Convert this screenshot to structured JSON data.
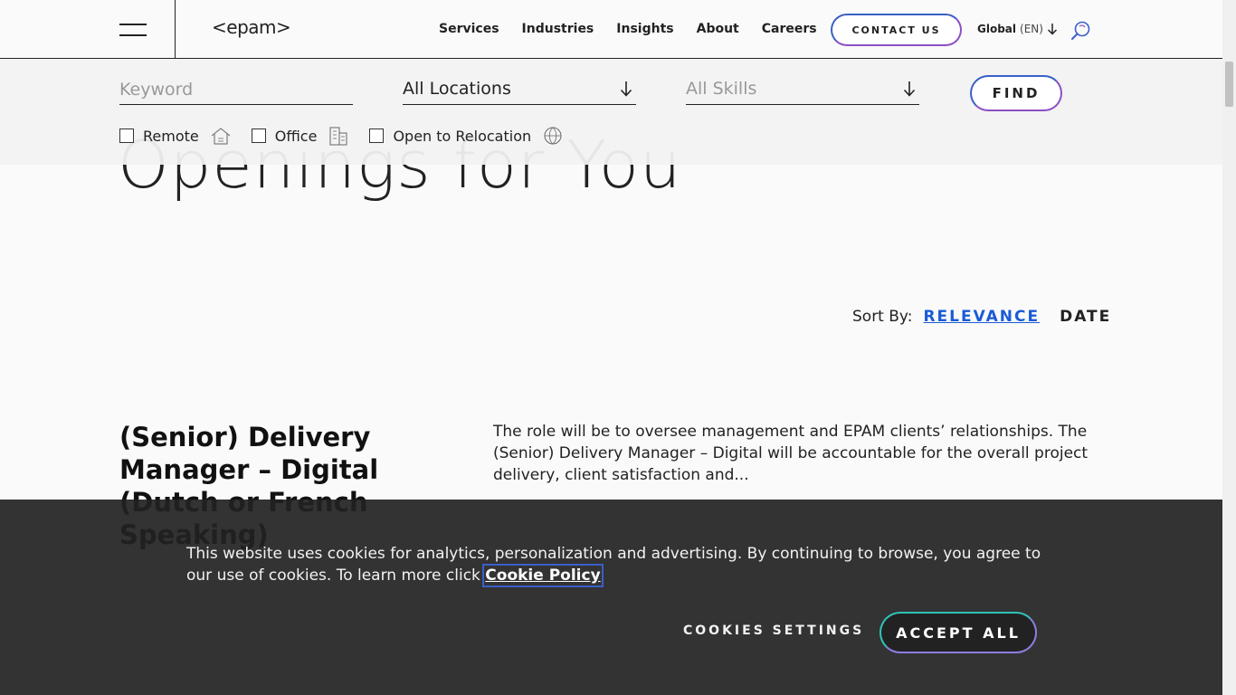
{
  "header": {
    "logo": "<epam>",
    "nav": [
      "Services",
      "Industries",
      "Insights",
      "About",
      "Careers"
    ],
    "contact_label": "CONTACT US",
    "global_label": "Global",
    "global_lang": "(EN)"
  },
  "filters": {
    "keyword_placeholder": "Keyword",
    "location_value": "All Locations",
    "skills_value": "All Skills",
    "find_label": "FIND",
    "checkboxes": [
      {
        "label": "Remote",
        "icon": "house-icon",
        "checked": false
      },
      {
        "label": "Office",
        "icon": "building-icon",
        "checked": false
      },
      {
        "label": "Open to Relocation",
        "icon": "globe-icon",
        "checked": false
      }
    ]
  },
  "page": {
    "title": "Openings for You"
  },
  "sort": {
    "label": "Sort By:",
    "relevance": "RELEVANCE",
    "date": "DATE"
  },
  "job": {
    "title": "(Senior) Delivery Manager – Digital (Dutch or French Speaking)",
    "description": "The role will be to oversee management and EPAM clients’ relationships. The (Senior) Delivery Manager – Digital will be accountable for the overall project delivery, client satisfaction and..."
  },
  "cookie": {
    "text": "This website uses cookies for analytics, personalization and advertising. By continuing to browse, you agree to our use of cookies. To learn more click ",
    "link": "Cookie Policy",
    "settings_label": "COOKIES SETTINGS",
    "accept_label": "ACCEPT ALL"
  }
}
